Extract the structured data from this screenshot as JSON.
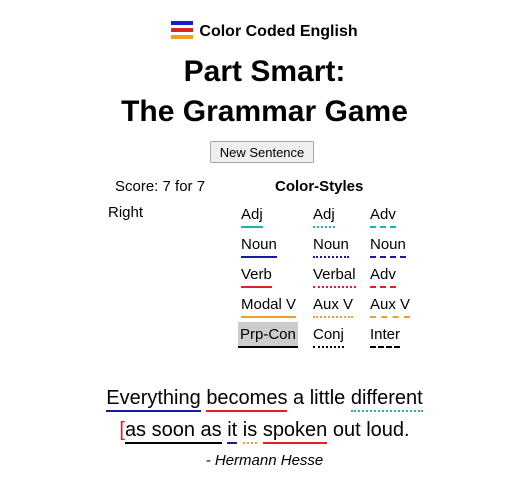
{
  "brand": {
    "name": "Color Coded English",
    "flag_colors": [
      "#1122cc",
      "#dd2222",
      "#f0a020"
    ]
  },
  "title": {
    "line1": "Part Smart:",
    "line2": "The Grammar Game"
  },
  "new_sentence_label": "New Sentence",
  "score": {
    "line1": "Score: 7 for 7",
    "line2": "Right"
  },
  "color_styles": {
    "title": "Color-Styles",
    "items": [
      {
        "label": "Adj",
        "color": "#20b2aa",
        "style": "solid"
      },
      {
        "label": "Adj",
        "color": "#20b2aa",
        "style": "dotted"
      },
      {
        "label": "Adv",
        "color": "#20b2aa",
        "style": "dashed"
      },
      {
        "label": "Noun",
        "color": "#1a1aa0",
        "style": "solid"
      },
      {
        "label": "Noun",
        "color": "#1a1aa0",
        "style": "dotted"
      },
      {
        "label": "Noun",
        "color": "#1a1aa0",
        "style": "dashed"
      },
      {
        "label": "Verb",
        "color": "#dd2222",
        "style": "solid"
      },
      {
        "label": "Verbal",
        "color": "#dd2222",
        "style": "dotted"
      },
      {
        "label": "Adv",
        "color": "#dd2222",
        "style": "dashed"
      },
      {
        "label": "Modal V",
        "color": "#f0a020",
        "style": "solid"
      },
      {
        "label": "Aux V",
        "color": "#f0a020",
        "style": "dotted"
      },
      {
        "label": "Aux V",
        "color": "#f0a020",
        "style": "dashed"
      },
      {
        "label": "Prp-Con",
        "color": "#000000",
        "style": "solid",
        "selected": true
      },
      {
        "label": "Conj",
        "color": "#000000",
        "style": "dotted"
      },
      {
        "label": "Inter",
        "color": "#000000",
        "style": "dashed"
      }
    ]
  },
  "quote": {
    "line1": [
      {
        "text": "Everything",
        "color": "#1a1aa0",
        "style": "solid"
      },
      {
        "text": " "
      },
      {
        "text": "becomes",
        "color": "#dd2222",
        "style": "solid"
      },
      {
        "text": " a little "
      },
      {
        "text": "different",
        "color": "#20b2aa",
        "style": "dotted"
      }
    ],
    "line2": [
      {
        "text": "[",
        "mark": "#dd2222"
      },
      {
        "text": "as soon as",
        "color": "#000000",
        "style": "solid"
      },
      {
        "text": " "
      },
      {
        "text": "it",
        "color": "#1a1aa0",
        "style": "solid"
      },
      {
        "text": " "
      },
      {
        "text": "is",
        "color": "#f0a020",
        "style": "dotted"
      },
      {
        "text": " "
      },
      {
        "text": "spoken",
        "color": "#dd2222",
        "style": "solid"
      },
      {
        "text": " out loud."
      }
    ],
    "author": "- Hermann Hesse"
  }
}
